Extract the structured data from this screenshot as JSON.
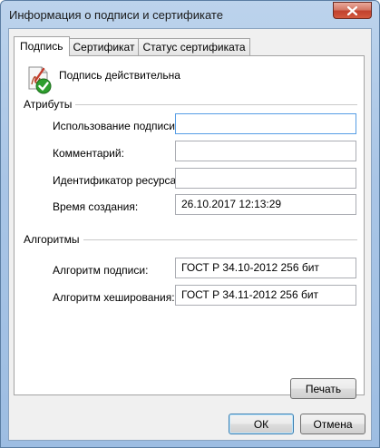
{
  "window": {
    "title": "Информация о подписи и сертификате",
    "close_icon": "close-icon"
  },
  "tabs": [
    {
      "label": "Подпись",
      "active": true
    },
    {
      "label": "Сертификат",
      "active": false
    },
    {
      "label": "Статус сертификата",
      "active": false
    }
  ],
  "signature": {
    "status_icon": "signature-valid-icon",
    "status_text": "Подпись действительна"
  },
  "attributes": {
    "group_label": "Атрибуты",
    "fields": [
      {
        "label": "Использование подписи:",
        "value": ""
      },
      {
        "label": "Комментарий:",
        "value": ""
      },
      {
        "label": "Идентификатор ресурса:",
        "value": ""
      },
      {
        "label": "Время создания:",
        "value": "26.10.2017 12:13:29"
      }
    ]
  },
  "algorithms": {
    "group_label": "Алгоритмы",
    "fields": [
      {
        "label": "Алгоритм подписи:",
        "value": "ГОСТ Р 34.10-2012 256 бит"
      },
      {
        "label": "Алгоритм хеширования:",
        "value": "ГОСТ Р 34.11-2012 256 бит"
      }
    ]
  },
  "buttons": {
    "print": "Печать",
    "ok": "ОК",
    "cancel": "Отмена"
  },
  "colors": {
    "titlebar": "#a9c5e6",
    "close_button": "#c1412d",
    "check_green": "#2e9e2e"
  }
}
